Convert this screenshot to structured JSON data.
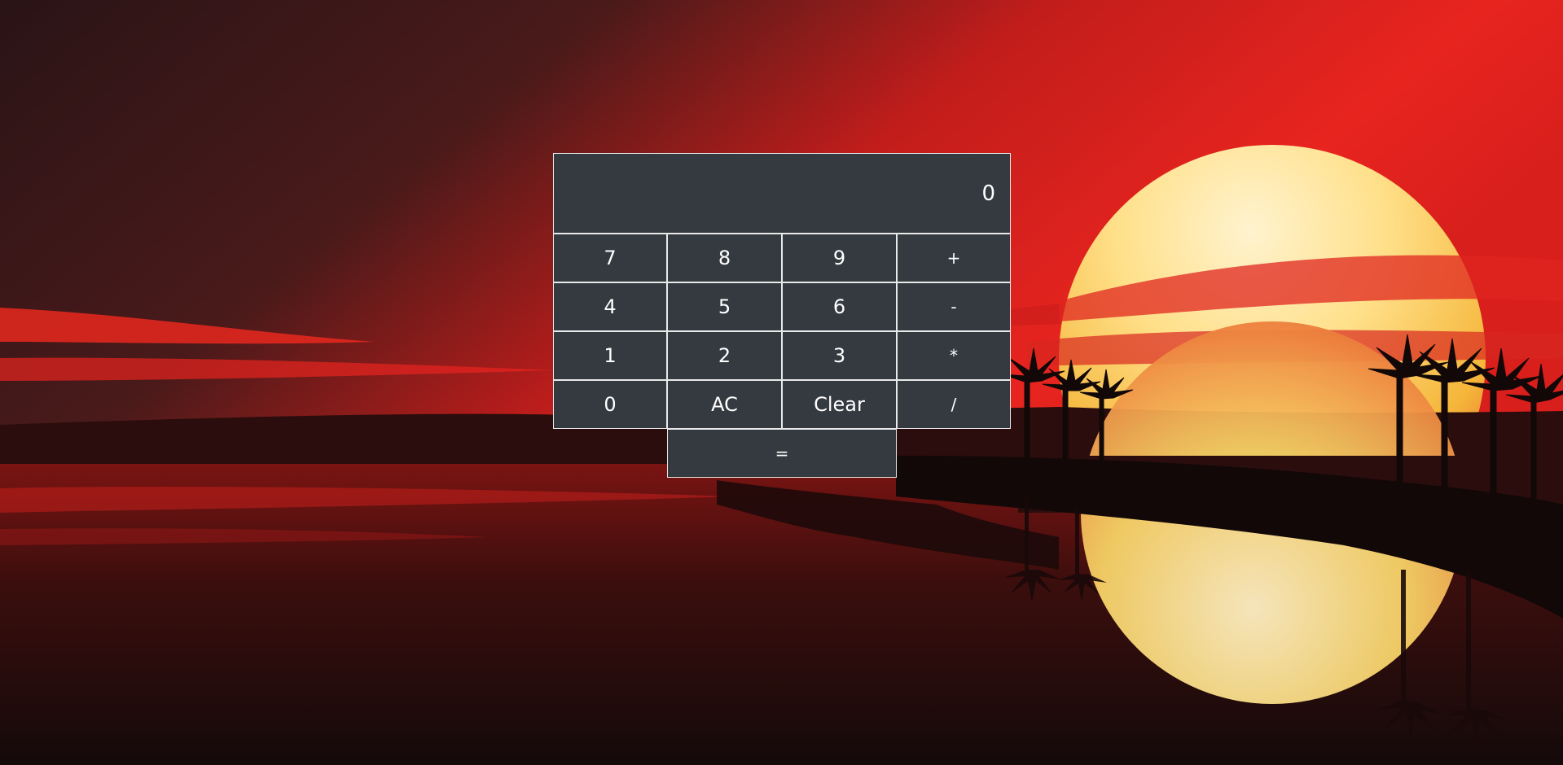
{
  "background": {
    "description_colors": {
      "sky_dark": "#2a1416",
      "sky_red": "#e0201e",
      "sun_core": "#fff3cf",
      "sun_edge": "#f7c84a",
      "water_dark": "#170c0c",
      "silhouette": "#120808"
    }
  },
  "calculator": {
    "display_value": "0",
    "colors": {
      "key_bg": "#343a40",
      "key_border": "#e9e9e9",
      "key_text": "#ffffff"
    },
    "keys": [
      {
        "label": "7",
        "name": "key-7"
      },
      {
        "label": "8",
        "name": "key-8"
      },
      {
        "label": "9",
        "name": "key-9"
      },
      {
        "label": "+",
        "name": "key-plus"
      },
      {
        "label": "4",
        "name": "key-4"
      },
      {
        "label": "5",
        "name": "key-5"
      },
      {
        "label": "6",
        "name": "key-6"
      },
      {
        "label": "-",
        "name": "key-minus"
      },
      {
        "label": "1",
        "name": "key-1"
      },
      {
        "label": "2",
        "name": "key-2"
      },
      {
        "label": "3",
        "name": "key-3"
      },
      {
        "label": "*",
        "name": "key-multiply"
      },
      {
        "label": "0",
        "name": "key-0"
      },
      {
        "label": "AC",
        "name": "key-ac"
      },
      {
        "label": "Clear",
        "name": "key-clear"
      },
      {
        "label": "/",
        "name": "key-divide"
      }
    ],
    "equals_label": "="
  }
}
